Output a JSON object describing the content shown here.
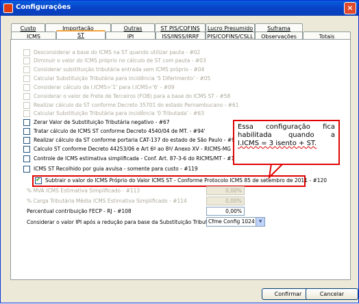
{
  "window": {
    "title": "Configurações",
    "close_glyph": "×"
  },
  "tabs_row1": [
    "Custo",
    "Importação",
    "Outras",
    "ST PIS/COFINS",
    "Lucro Presumido",
    "Suframa"
  ],
  "tabs_row2": [
    "ICMS",
    "ST",
    "IPI",
    "ISS/INSS/IRRF",
    "PIS/COFINS/CSLL",
    "Observações",
    "Totais"
  ],
  "active_tab": "ST",
  "options": [
    {
      "label": "Desconsiderar a base do ICMS na ST quando utilizar pauta - #02",
      "enabled": false,
      "checked": false
    },
    {
      "label": "Diminuir o valor do ICMS próprio no cálculo de ST com pauta - #03",
      "enabled": false,
      "checked": false
    },
    {
      "label": "Considerar substituição tributária entrada sem ICMS próprio - #04",
      "enabled": false,
      "checked": false
    },
    {
      "label": "Calcular Substituição Tributária para incidência '5 Diferimento' - #05",
      "enabled": false,
      "checked": false
    },
    {
      "label": "Considerar cálculo da I.ICMS='1' para I.ICMS='6' - #09",
      "enabled": false,
      "checked": false
    },
    {
      "label": "Considerar o valor de Frete de Terceiros (FOB) para a base do ICMS ST - #58",
      "enabled": false,
      "checked": false
    },
    {
      "label": "Realizar cálculo da ST conforme Decreto 35701 do estado Pernambucano - #61",
      "enabled": false,
      "checked": false
    },
    {
      "label": "Calcular Substituição Tributária para incidência '0 Tributada' - #63",
      "enabled": false,
      "checked": false
    },
    {
      "label": "Zerar Valor de Substituição Tributária negativo - #67",
      "enabled": true,
      "checked": false
    },
    {
      "label": "Tratar cálculo de ICMS ST conforme Decreto 4540/04 de MT. - #94'",
      "enabled": true,
      "checked": false
    },
    {
      "label": "Realizar cálculo da ST conforme portaria CAT-137 do estado de São Paulo - #98",
      "enabled": true,
      "checked": false
    },
    {
      "label": "Calculo ST conforme Decreto 44253/06 e Art 6º ao 8º/ Anexo XV - RICMS-MG - #110",
      "enabled": true,
      "checked": false
    },
    {
      "label": "Controle de ICMS estimativa simplificada - Conf. Art. 87-3-6 do RICMS/MT - #112",
      "enabled": true,
      "checked": false
    },
    {
      "label": "ICMS ST Recolhido por guia avulsa - somente para custo - #119",
      "enabled": true,
      "checked": false
    },
    {
      "label": "Subtrair o valor do ICMS Próprio do Valor ICMS ST - Conforme Protocolo ICMS 85 de setembro de 2011 - #120",
      "enabled": true,
      "checked": true
    }
  ],
  "fields": [
    {
      "label": "% MVA ICMS Estimativa Simplificado - #113",
      "value": "0,00%",
      "enabled": false
    },
    {
      "label": "% Carga Tributária Média ICMS Estimativa Simplificado - #114",
      "value": "0,00%",
      "enabled": false
    },
    {
      "label": "Percentual contribuição FECP - RJ - #108",
      "value": "0,00%",
      "enabled": true
    }
  ],
  "select": {
    "label": "Considerar o valor IPI após a redução para base da Substituição Tributária - #71",
    "value": "Cfme Config 1024",
    "arrow_glyph": "▼"
  },
  "callout": {
    "lines": [
      "Essa configuração fica",
      "habilitada quando a",
      "I.ICMS = 3 isento + ST."
    ]
  },
  "buttons": {
    "confirm": "Confirmar",
    "cancel": "Cancelar"
  },
  "colors": {
    "highlight": "#e00000",
    "title_bar": "#0742c8"
  }
}
